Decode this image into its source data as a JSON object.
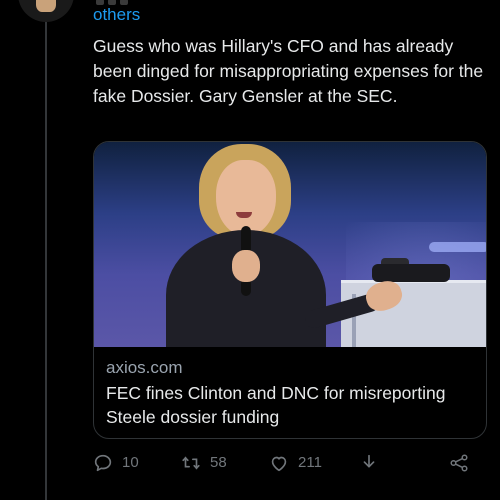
{
  "header": {
    "replying_text": "others"
  },
  "tweet": {
    "text": "Guess who was Hillary's CFO and has already been dinged for misappropriating expenses for the fake Dossier. Gary Gensler at the SEC."
  },
  "card": {
    "domain": "axios.com",
    "headline": "FEC fines Clinton and DNC for misreporting Steele dossier funding"
  },
  "actions": {
    "reply_count": "10",
    "retweet_count": "58",
    "like_count": "211"
  },
  "icons": [
    "reply-icon",
    "retweet-icon",
    "like-icon",
    "download-icon",
    "share-icon"
  ],
  "colors": {
    "background": "#000000",
    "accent": "#1d9bf0",
    "text": "#e7e9ea",
    "muted": "#71767b"
  }
}
